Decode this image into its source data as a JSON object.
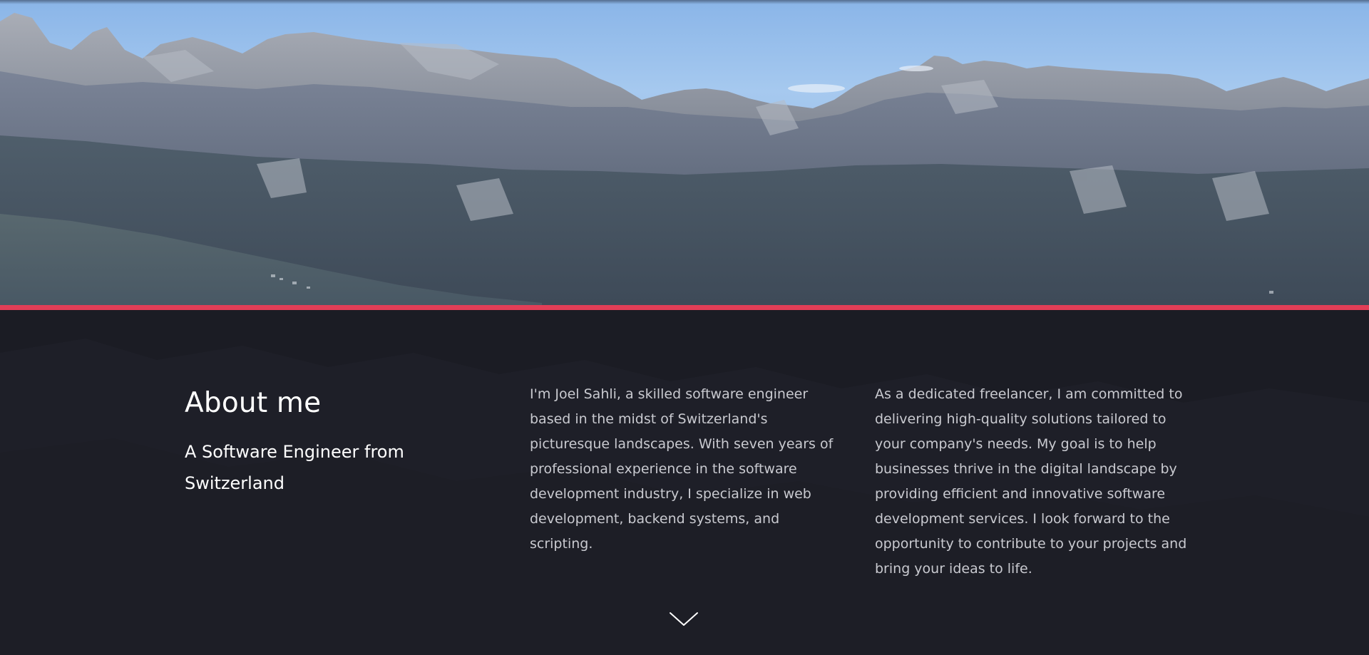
{
  "theme": {
    "accent_color": "#e23e57",
    "section_background": "#1b1c24",
    "heading_color": "#ffffff",
    "body_text_color": "#c9cad0"
  },
  "hero": {
    "image": "mountain-landscape-photo"
  },
  "about": {
    "title": "About me",
    "subtitle": "A Software Engineer from Switzerland",
    "paragraph_1": "I'm Joel Sahli, a skilled software engineer based in the midst of Switzerland's picturesque landscapes. With seven years of professional experience in the software development industry, I specialize in web development, backend systems, and scripting.",
    "paragraph_2": "As a dedicated freelancer, I am committed to delivering high-quality solutions tailored to your company's needs. My goal is to help businesses thrive in the digital landscape by providing efficient and innovative software development services. I look forward to the opportunity to contribute to your projects and bring your ideas to life."
  },
  "scroll_indicator": {
    "icon": "chevron-down-icon"
  }
}
